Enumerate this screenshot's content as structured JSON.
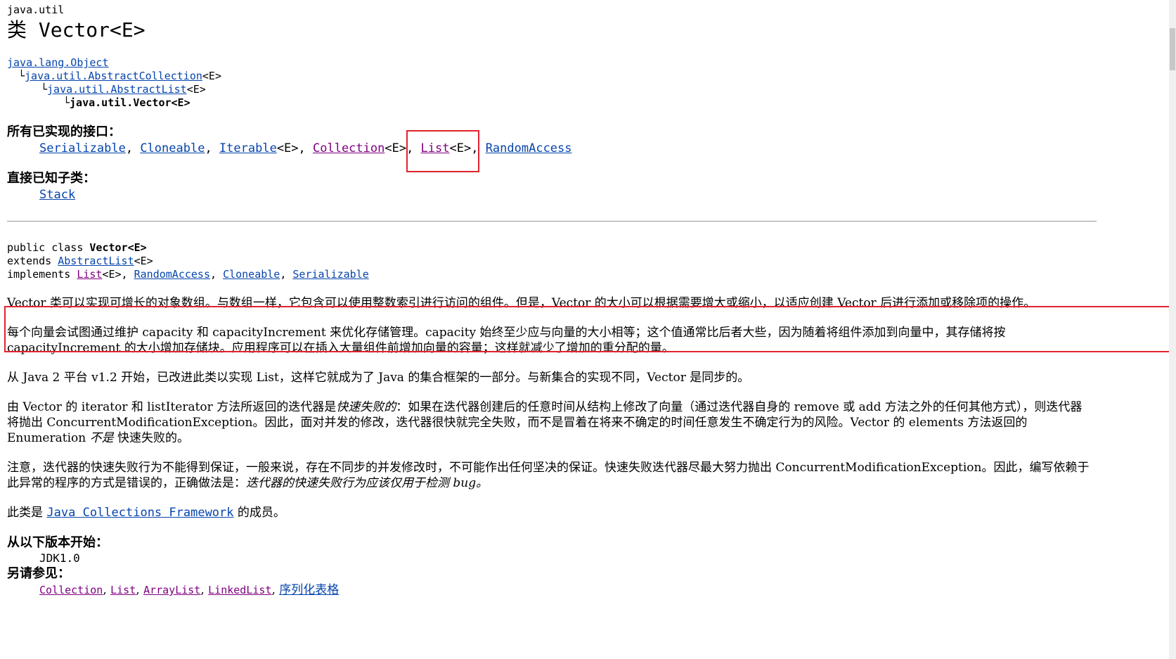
{
  "header": {
    "package": "java.util",
    "class_title": "类 Vector<E>"
  },
  "hierarchy": {
    "root_link": "java.lang.Object",
    "line2_prefix": "└",
    "line2_link": "java.util.AbstractCollection",
    "line2_suffix": "<E>",
    "line3_prefix": "└",
    "line3_link": "java.util.AbstractList",
    "line3_suffix": "<E>",
    "line4_prefix": "└",
    "line4_text": "java.util.Vector<E>"
  },
  "interfaces": {
    "title": "所有已实现的接口：",
    "items": [
      {
        "link": "Serializable",
        "suffix": ", "
      },
      {
        "link": "Cloneable",
        "suffix": ", "
      },
      {
        "link": "Iterable",
        "suffix": "<E>, "
      },
      {
        "link": "Collection",
        "suffix": "<E>, "
      },
      {
        "link": "List",
        "suffix": "<E>, "
      },
      {
        "link": "RandomAccess",
        "suffix": ""
      }
    ]
  },
  "subclasses": {
    "title": "直接已知子类：",
    "link": "Stack"
  },
  "declaration": {
    "line1_prefix": "public class ",
    "line1_name": "Vector<E>",
    "line2_prefix": "extends ",
    "line2_link": "AbstractList",
    "line2_suffix": "<E>",
    "line3_prefix": "implements ",
    "line3_link1": "List",
    "line3_sep1": "<E>, ",
    "line3_link2": "RandomAccess",
    "line3_sep2": ", ",
    "line3_link3": "Cloneable",
    "line3_sep3": ", ",
    "line3_link4": "Serializable"
  },
  "paragraphs": {
    "p1": "Vector 类可以实现可增长的对象数组。与数组一样，它包含可以使用整数索引进行访问的组件。但是，Vector 的大小可以根据需要增大或缩小，以适应创建 Vector 后进行添加或移除项的操作。",
    "p2": "每个向量会试图通过维护 capacity 和 capacityIncrement 来优化存储管理。capacity 始终至少应与向量的大小相等；这个值通常比后者大些，因为随着将组件添加到向量中，其存储将按 capacityIncrement 的大小增加存储块。应用程序可以在插入大量组件前增加向量的容量；这样就减少了增加的重分配的量。",
    "p3": "从 Java 2 平台 v1.2 开始，已改进此类以实现 List，这样它就成为了 Java 的集合框架的一部分。与新集合的实现不同，Vector 是同步的。",
    "p4_a": "由 Vector 的 iterator 和 listIterator 方法所返回的迭代器是",
    "p4_em1": "快速失败的",
    "p4_b": "：如果在迭代器创建后的任意时间从结构上修改了向量（通过迭代器自身的 remove 或 add 方法之外的任何其他方式），则迭代器将抛出 ConcurrentModificationException。因此，面对并发的修改，迭代器很快就完全失败，而不是冒着在将来不确定的时间任意发生不确定行为的风险。Vector 的 elements 方法返回的 Enumeration ",
    "p4_em2": "不是",
    "p4_c": " 快速失败的。",
    "p5_a": "注意，迭代器的快速失败行为不能得到保证，一般来说，存在不同步的并发修改时，不可能作出任何坚决的保证。快速失败迭代器尽最大努力抛出 ConcurrentModificationException。因此，编写依赖于此异常的程序的方式是错误的，正确做法是：",
    "p5_em": "迭代器的快速失败行为应该仅用于检测 bug。",
    "p6_a": "此类是 ",
    "p6_link": "Java Collections Framework",
    "p6_b": " 的成员。"
  },
  "since": {
    "title": "从以下版本开始：",
    "value": "JDK1.0"
  },
  "see_also": {
    "title": "另请参见：",
    "items": [
      {
        "link": "Collection",
        "suffix": ", "
      },
      {
        "link": "List",
        "suffix": ", "
      },
      {
        "link": "ArrayList",
        "suffix": ", "
      },
      {
        "link": "LinkedList",
        "suffix": ", "
      },
      {
        "link": "序列化表格",
        "suffix": ""
      }
    ]
  },
  "colors": {
    "link": "#0645ad",
    "visited": "#800080",
    "highlight": "#e0232d"
  }
}
